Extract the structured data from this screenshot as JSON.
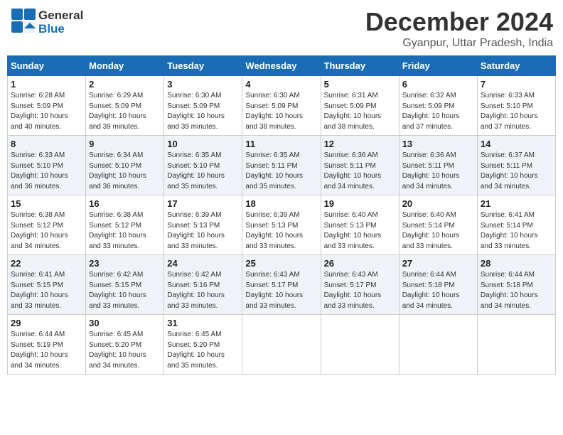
{
  "header": {
    "logo_line1": "General",
    "logo_line2": "Blue",
    "month_title": "December 2024",
    "subtitle": "Gyanpur, Uttar Pradesh, India"
  },
  "weekdays": [
    "Sunday",
    "Monday",
    "Tuesday",
    "Wednesday",
    "Thursday",
    "Friday",
    "Saturday"
  ],
  "weeks": [
    [
      {
        "day": "1",
        "info": "Sunrise: 6:28 AM\nSunset: 5:09 PM\nDaylight: 10 hours\nand 40 minutes."
      },
      {
        "day": "2",
        "info": "Sunrise: 6:29 AM\nSunset: 5:09 PM\nDaylight: 10 hours\nand 39 minutes."
      },
      {
        "day": "3",
        "info": "Sunrise: 6:30 AM\nSunset: 5:09 PM\nDaylight: 10 hours\nand 39 minutes."
      },
      {
        "day": "4",
        "info": "Sunrise: 6:30 AM\nSunset: 5:09 PM\nDaylight: 10 hours\nand 38 minutes."
      },
      {
        "day": "5",
        "info": "Sunrise: 6:31 AM\nSunset: 5:09 PM\nDaylight: 10 hours\nand 38 minutes."
      },
      {
        "day": "6",
        "info": "Sunrise: 6:32 AM\nSunset: 5:09 PM\nDaylight: 10 hours\nand 37 minutes."
      },
      {
        "day": "7",
        "info": "Sunrise: 6:33 AM\nSunset: 5:10 PM\nDaylight: 10 hours\nand 37 minutes."
      }
    ],
    [
      {
        "day": "8",
        "info": "Sunrise: 6:33 AM\nSunset: 5:10 PM\nDaylight: 10 hours\nand 36 minutes."
      },
      {
        "day": "9",
        "info": "Sunrise: 6:34 AM\nSunset: 5:10 PM\nDaylight: 10 hours\nand 36 minutes."
      },
      {
        "day": "10",
        "info": "Sunrise: 6:35 AM\nSunset: 5:10 PM\nDaylight: 10 hours\nand 35 minutes."
      },
      {
        "day": "11",
        "info": "Sunrise: 6:35 AM\nSunset: 5:11 PM\nDaylight: 10 hours\nand 35 minutes."
      },
      {
        "day": "12",
        "info": "Sunrise: 6:36 AM\nSunset: 5:11 PM\nDaylight: 10 hours\nand 34 minutes."
      },
      {
        "day": "13",
        "info": "Sunrise: 6:36 AM\nSunset: 5:11 PM\nDaylight: 10 hours\nand 34 minutes."
      },
      {
        "day": "14",
        "info": "Sunrise: 6:37 AM\nSunset: 5:11 PM\nDaylight: 10 hours\nand 34 minutes."
      }
    ],
    [
      {
        "day": "15",
        "info": "Sunrise: 6:38 AM\nSunset: 5:12 PM\nDaylight: 10 hours\nand 34 minutes."
      },
      {
        "day": "16",
        "info": "Sunrise: 6:38 AM\nSunset: 5:12 PM\nDaylight: 10 hours\nand 33 minutes."
      },
      {
        "day": "17",
        "info": "Sunrise: 6:39 AM\nSunset: 5:13 PM\nDaylight: 10 hours\nand 33 minutes."
      },
      {
        "day": "18",
        "info": "Sunrise: 6:39 AM\nSunset: 5:13 PM\nDaylight: 10 hours\nand 33 minutes."
      },
      {
        "day": "19",
        "info": "Sunrise: 6:40 AM\nSunset: 5:13 PM\nDaylight: 10 hours\nand 33 minutes."
      },
      {
        "day": "20",
        "info": "Sunrise: 6:40 AM\nSunset: 5:14 PM\nDaylight: 10 hours\nand 33 minutes."
      },
      {
        "day": "21",
        "info": "Sunrise: 6:41 AM\nSunset: 5:14 PM\nDaylight: 10 hours\nand 33 minutes."
      }
    ],
    [
      {
        "day": "22",
        "info": "Sunrise: 6:41 AM\nSunset: 5:15 PM\nDaylight: 10 hours\nand 33 minutes."
      },
      {
        "day": "23",
        "info": "Sunrise: 6:42 AM\nSunset: 5:15 PM\nDaylight: 10 hours\nand 33 minutes."
      },
      {
        "day": "24",
        "info": "Sunrise: 6:42 AM\nSunset: 5:16 PM\nDaylight: 10 hours\nand 33 minutes."
      },
      {
        "day": "25",
        "info": "Sunrise: 6:43 AM\nSunset: 5:17 PM\nDaylight: 10 hours\nand 33 minutes."
      },
      {
        "day": "26",
        "info": "Sunrise: 6:43 AM\nSunset: 5:17 PM\nDaylight: 10 hours\nand 33 minutes."
      },
      {
        "day": "27",
        "info": "Sunrise: 6:44 AM\nSunset: 5:18 PM\nDaylight: 10 hours\nand 34 minutes."
      },
      {
        "day": "28",
        "info": "Sunrise: 6:44 AM\nSunset: 5:18 PM\nDaylight: 10 hours\nand 34 minutes."
      }
    ],
    [
      {
        "day": "29",
        "info": "Sunrise: 6:44 AM\nSunset: 5:19 PM\nDaylight: 10 hours\nand 34 minutes."
      },
      {
        "day": "30",
        "info": "Sunrise: 6:45 AM\nSunset: 5:20 PM\nDaylight: 10 hours\nand 34 minutes."
      },
      {
        "day": "31",
        "info": "Sunrise: 6:45 AM\nSunset: 5:20 PM\nDaylight: 10 hours\nand 35 minutes."
      },
      {
        "day": "",
        "info": ""
      },
      {
        "day": "",
        "info": ""
      },
      {
        "day": "",
        "info": ""
      },
      {
        "day": "",
        "info": ""
      }
    ]
  ]
}
